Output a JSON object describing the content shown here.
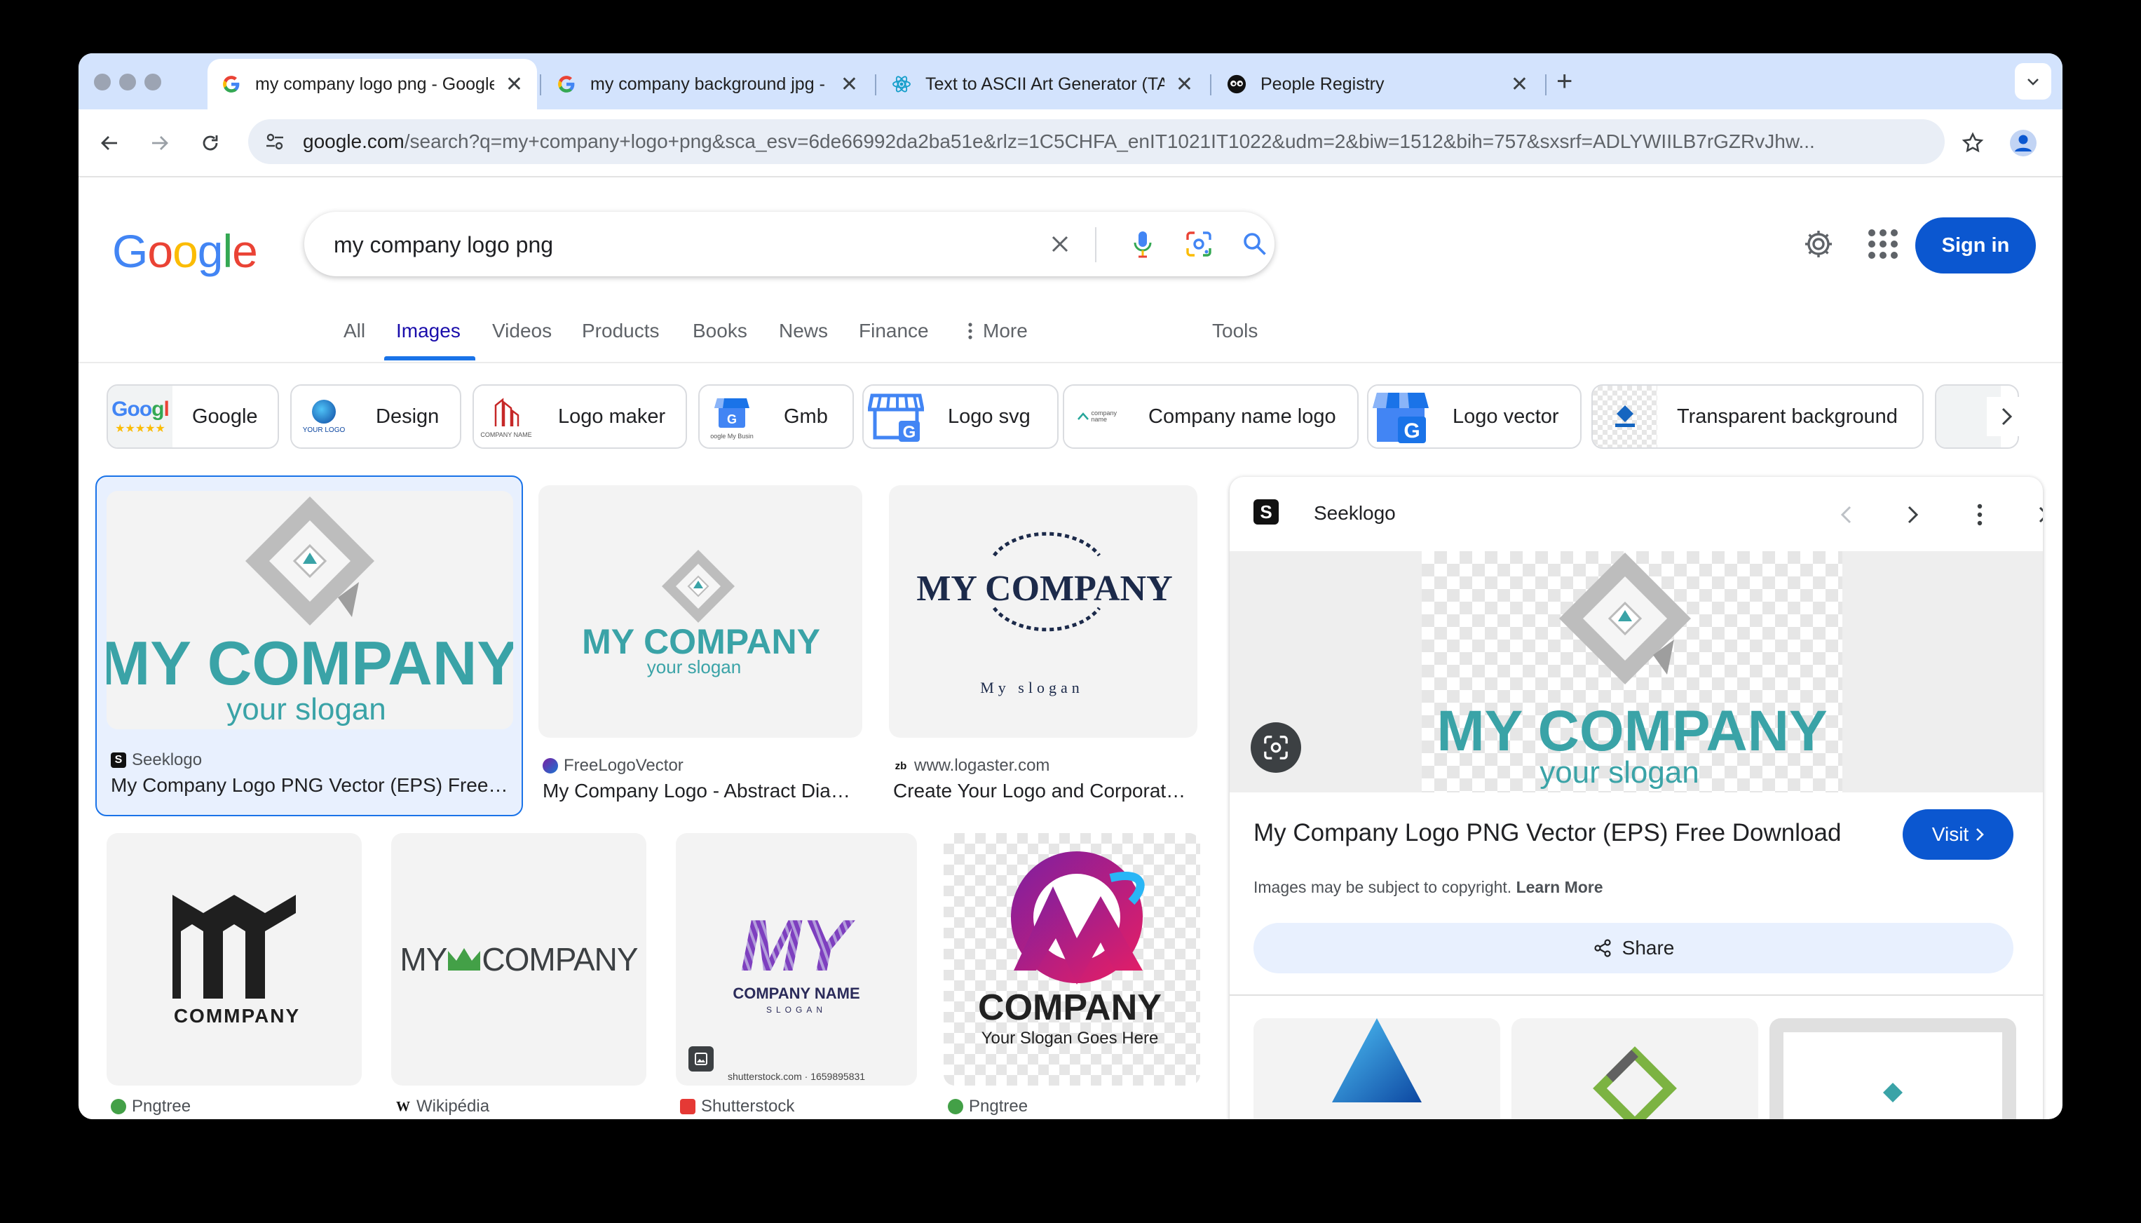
{
  "browser": {
    "tabs": [
      {
        "title": "my company logo png - Google Search",
        "active": true
      },
      {
        "title": "my company background jpg - Google Search",
        "active": false
      },
      {
        "title": "Text to ASCII Art Generator (TAAG)",
        "active": false
      },
      {
        "title": "People Registry",
        "active": false
      }
    ],
    "url_host": "google.com",
    "url_path": "/search?q=my+company+logo+png&sca_esv=6de66992da2ba51e&rlz=1C5CHFA_enIT1021IT1022&udm=2&biw=1512&bih=757&sxsrf=ADLYWIILB7rGZRvJhw..."
  },
  "google": {
    "logo": "Google",
    "query": "my company logo png",
    "sign_in": "Sign in",
    "tabs": [
      "All",
      "Images",
      "Videos",
      "Products",
      "Books",
      "News",
      "Finance",
      "More",
      "Tools"
    ],
    "chips": [
      "Google",
      "Design",
      "Logo maker",
      "Gmb",
      "Logo svg",
      "Company name logo",
      "Logo vector",
      "Transparent background"
    ],
    "chip_thumb_text": {
      "google": "Googl",
      "design": "YOUR LOGO",
      "logo_maker": "COMPANY NAME",
      "gmb": "oogle My Busin",
      "company_name": "company name"
    }
  },
  "results": {
    "row1": [
      {
        "source": "Seeklogo",
        "caption": "My Company Logo PNG Vector (EPS) Free Download",
        "logo_text": "MY COMPANY",
        "slogan": "your slogan"
      },
      {
        "source": "FreeLogoVector",
        "caption": "My Company Logo - Abstract Diamond",
        "logo_text": "MY COMPANY",
        "slogan": "your slogan"
      },
      {
        "source": "www.logaster.com",
        "caption": "Create Your Logo and Corporate Identity",
        "logo_text": "MY COMPANY",
        "slogan": "My slogan"
      }
    ],
    "row2": [
      {
        "source": "Pngtree",
        "logo_text": "COMMPANY"
      },
      {
        "source": "Wikipédia",
        "logo_text_a": "MY",
        "logo_text_b": "COMPANY"
      },
      {
        "source": "Shutterstock",
        "logo_text": "MY",
        "sub1": "COMPANY NAME",
        "sub2": "SLOGAN",
        "watermark": "shutterstock.com · 1659895831"
      },
      {
        "source": "Pngtree",
        "logo_text": "COMPANY",
        "slogan": "Your Slogan Goes Here"
      }
    ]
  },
  "panel": {
    "site": "Seeklogo",
    "title": "My Company Logo PNG Vector (EPS) Free Download",
    "visit": "Visit",
    "copyright": "Images may be subject to copyright.",
    "learn_more": "Learn More",
    "share": "Share",
    "logo_text": "MY COMPANY",
    "slogan": "your slogan"
  },
  "colors": {
    "accent": "#0b57d0",
    "teal": "#3aa3a7",
    "tabstrip": "#d3e3fd"
  }
}
